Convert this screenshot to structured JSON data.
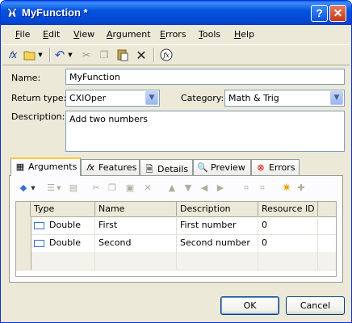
{
  "window": {
    "title": "MyFunction *"
  },
  "menu": [
    "File",
    "Edit",
    "View",
    "Argument",
    "Errors",
    "Tools",
    "Help"
  ],
  "menu_access": [
    "F",
    "E",
    "V",
    "A",
    "E",
    "T",
    "H"
  ],
  "toolbar": [
    "new-function-icon",
    "open-folder-icon",
    "dropdown-arrow-icon",
    "undo-icon",
    "dropdown-arrow-icon",
    "cut-icon",
    "copy-icon",
    "paste-icon",
    "delete-icon",
    "function-wizard-icon"
  ],
  "form": {
    "name_label": "Name:",
    "name_value": "MyFunction",
    "return_type_label": "Return type:",
    "return_type_value": "CXlOper",
    "category_label": "Category:",
    "category_value": "Math & Trig",
    "description_label": "Description:",
    "description_value": "Add two numbers"
  },
  "tabs": [
    {
      "label": "Arguments",
      "active": true
    },
    {
      "label": "Features"
    },
    {
      "label": "Details"
    },
    {
      "label": "Preview"
    },
    {
      "label": "Errors"
    }
  ],
  "grid": {
    "columns": [
      "Type",
      "Name",
      "Description",
      "Resource ID"
    ],
    "rows": [
      {
        "type": "Double",
        "name": "First",
        "description": "First number",
        "resource_id": "0"
      },
      {
        "type": "Double",
        "name": "Second",
        "description": "Second number",
        "resource_id": "0"
      }
    ]
  },
  "buttons": {
    "ok": "OK",
    "cancel": "Cancel"
  },
  "colors": {
    "title_bar": "#0453dc",
    "dialog_bg": "#ece9d8",
    "active_tab_accent": "#ffc83c"
  }
}
